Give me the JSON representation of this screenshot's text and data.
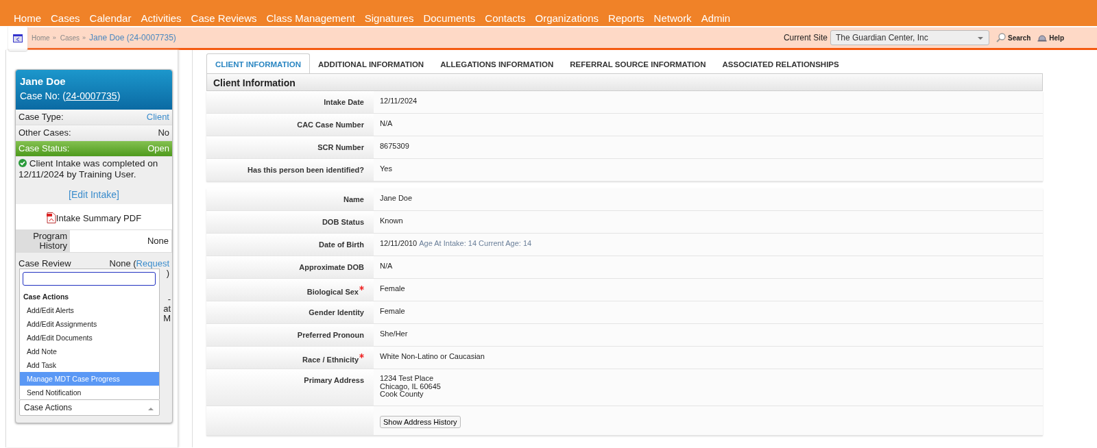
{
  "nav": [
    "Home",
    "Cases",
    "Calendar",
    "Activities",
    "Case Reviews",
    "Class Management",
    "Signatures",
    "Documents",
    "Contacts",
    "Organizations",
    "Reports",
    "Network",
    "Admin"
  ],
  "breadcrumb": {
    "items": [
      "Home",
      "Cases"
    ],
    "separator": "»",
    "current": "Jane Doe (24-0007735)"
  },
  "site": {
    "label": "Current Site",
    "value": "The Guardian Center, Inc"
  },
  "top_links": [
    "Search",
    "Help"
  ],
  "case": {
    "name": "Jane Doe",
    "case_no_label": "Case No: (",
    "case_no": "24-0007735",
    "case_no_end": ")",
    "rows": [
      {
        "label": "Case Type:",
        "value": "Client",
        "kind": "link"
      },
      {
        "label": "Other Cases:",
        "value": "No",
        "kind": "plain"
      },
      {
        "label": "Case Status:",
        "value": "Open",
        "kind": "status"
      }
    ],
    "intake_note": "Client Intake was completed on 12/11/2024 by Training User.",
    "edit_intake": "[Edit Intake]",
    "pdf": "Intake Summary PDF",
    "program_history": {
      "label": "Program History",
      "value": "None"
    },
    "case_review": {
      "label": "Case Review",
      "value": "None (",
      "link": "Request",
      "tail": ")"
    },
    "fragments": [
      "-",
      "at",
      "M"
    ]
  },
  "actions": {
    "group": "Case Actions",
    "options": [
      {
        "label": "Add/Edit Alerts",
        "selected": false
      },
      {
        "label": "Add/Edit Assignments",
        "selected": false
      },
      {
        "label": "Add/Edit Documents",
        "selected": false
      },
      {
        "label": "Add Note",
        "selected": false
      },
      {
        "label": "Add Task",
        "selected": false
      },
      {
        "label": "Manage MDT Case Progress",
        "selected": true
      },
      {
        "label": "Send Notification",
        "selected": false
      }
    ],
    "select_value": "Case Actions"
  },
  "tabs": [
    {
      "label": "CLIENT INFORMATION",
      "selected": true
    },
    {
      "label": "ADDITIONAL INFORMATION",
      "selected": false
    },
    {
      "label": "ALLEGATIONS INFORMATION",
      "selected": false
    },
    {
      "label": "REFERRAL SOURCE INFORMATION",
      "selected": false
    },
    {
      "label": "ASSOCIATED RELATIONSHIPS",
      "selected": false
    }
  ],
  "section_title": "Client Information",
  "groups": [
    [
      {
        "label": "Intake Date",
        "value": "12/11/2024"
      },
      {
        "label": "CAC Case Number",
        "value": "N/A"
      },
      {
        "label": "SCR Number",
        "value": "8675309"
      },
      {
        "label": "Has this person been identified?",
        "value": "Yes"
      }
    ],
    [
      {
        "label": "Name",
        "value": "Jane Doe"
      },
      {
        "label": "DOB Status",
        "value": "Known"
      },
      {
        "label": "Date of Birth",
        "value": "12/11/2010",
        "note": "Age At Intake: 14 Current Age: 14"
      },
      {
        "label": "Approximate DOB",
        "value": "N/A"
      },
      {
        "label": "Biological Sex",
        "value": "Female",
        "required": true
      },
      {
        "label": "Gender Identity",
        "value": "Female"
      },
      {
        "label": "Preferred Pronoun",
        "value": "She/Her"
      },
      {
        "label": "Race / Ethnicity",
        "value": "White Non-Latino or Caucasian",
        "required": true
      },
      {
        "label": "Primary Address",
        "lines": [
          "1234 Test Place",
          "Chicago, IL 60645",
          "Cook County"
        ]
      },
      {
        "button": "Show Address History"
      }
    ]
  ]
}
